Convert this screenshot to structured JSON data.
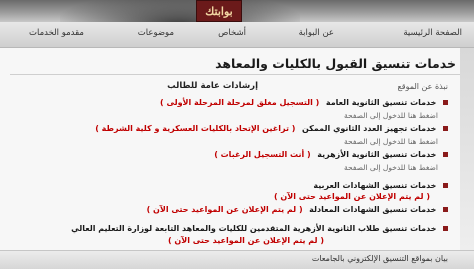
{
  "brand": {
    "logo_text": "بوابتك"
  },
  "nav": {
    "items": [
      "الصفحة الرئيسية",
      "عن البوابة",
      "أشخاص",
      "موضوعات",
      "مقدمو الخدمات"
    ]
  },
  "page": {
    "title": "خدمات تنسيق القبول بالكليات والمعاهد",
    "guidance": "إرشادات عامة للطالب",
    "guidance_sub": "اضغط هنا",
    "site_link": "نبذة عن الموقع"
  },
  "services": [
    {
      "title": "خدمات تنسيق الثانوية العامة",
      "note": "( التسجيل مغلق لمرحلة المرحلة الأولى )",
      "sub": "اضغط هنا للدخول إلى الصفحة"
    },
    {
      "title": "خدمات تجهيز العدد الثانوي الممكن",
      "note": "( تراغين الإتحاد بالكليات العسكرية و كلية الشرطة )",
      "sub": "اضغط هنا للدخول إلى الصفحة"
    },
    {
      "title": "خدمات تنسيق الثانوية الأزهرية",
      "note": "( أنت التسجيل الرغبات )",
      "sub": "اضغط هنا للدخول إلى الصفحة"
    },
    {
      "title": "خدمات تنسيق الشهادات العربية",
      "note": "( لم يتم الإعلان عن المواعيد حتى الآن )",
      "sub": ""
    },
    {
      "title": "خدمات تنسيق الشهادات المعادلة",
      "note": "( لم يتم الإعلان عن المواعيد حتى الآن )",
      "sub": ""
    },
    {
      "title": "خدمات تنسيق طلاب الثانوية الأزهرية المتقدمين للكليات والمعاهد التابعة لوزارة التعليم العالي",
      "note": "( لم يتم الإعلان عن المواعيد حتى الآن )",
      "sub": ""
    }
  ],
  "notes": {
    "arabic_certs": "( لم يتم الإعلان عن المواعيد حتى الآن )",
    "azhar_extra": "( لم يتم الإعلان عن المواعيد حتى الآن )"
  },
  "footer": {
    "link": "بيان بمواقع التنسيق الإلكتروني بالجامعات"
  }
}
